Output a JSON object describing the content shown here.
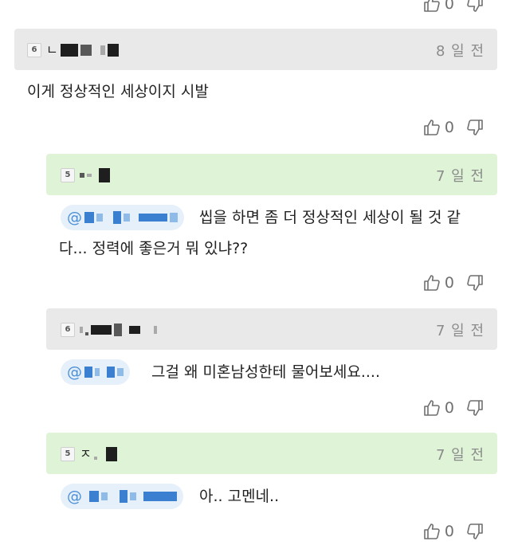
{
  "colors": {
    "gray_bar": "#e9e9e9",
    "green_bar": "#dff3d7",
    "mention_bg": "#e6f0fa",
    "mention_text": "#4b8fd6"
  },
  "icons": {
    "like": "thumbs-up-outline-icon",
    "dislike": "thumbs-down-outline-icon"
  },
  "top_votes": {
    "likes": "0"
  },
  "comments": [
    {
      "level": "6",
      "name_visible": "ㄴ",
      "time": "8 일 전",
      "text": "이게 정상적인 세상이지 시발",
      "likes": "0"
    },
    {
      "level": "5",
      "time": "7 일 전",
      "mention": "@",
      "text_line1": "씹을 하면 좀 더 정상적인 세상이 될 것 같",
      "text_line2": "다... 정력에 좋은거 뭐 있냐??",
      "likes": "0"
    },
    {
      "level": "6",
      "time": "7 일 전",
      "mention": "@",
      "text": "그걸 왜 미혼남성한테 물어보세요....",
      "likes": "0"
    },
    {
      "level": "5",
      "name_visible": "ㅈ",
      "time": "7 일 전",
      "mention": "@",
      "text": "아.. 고멘네..",
      "likes": "0"
    }
  ]
}
